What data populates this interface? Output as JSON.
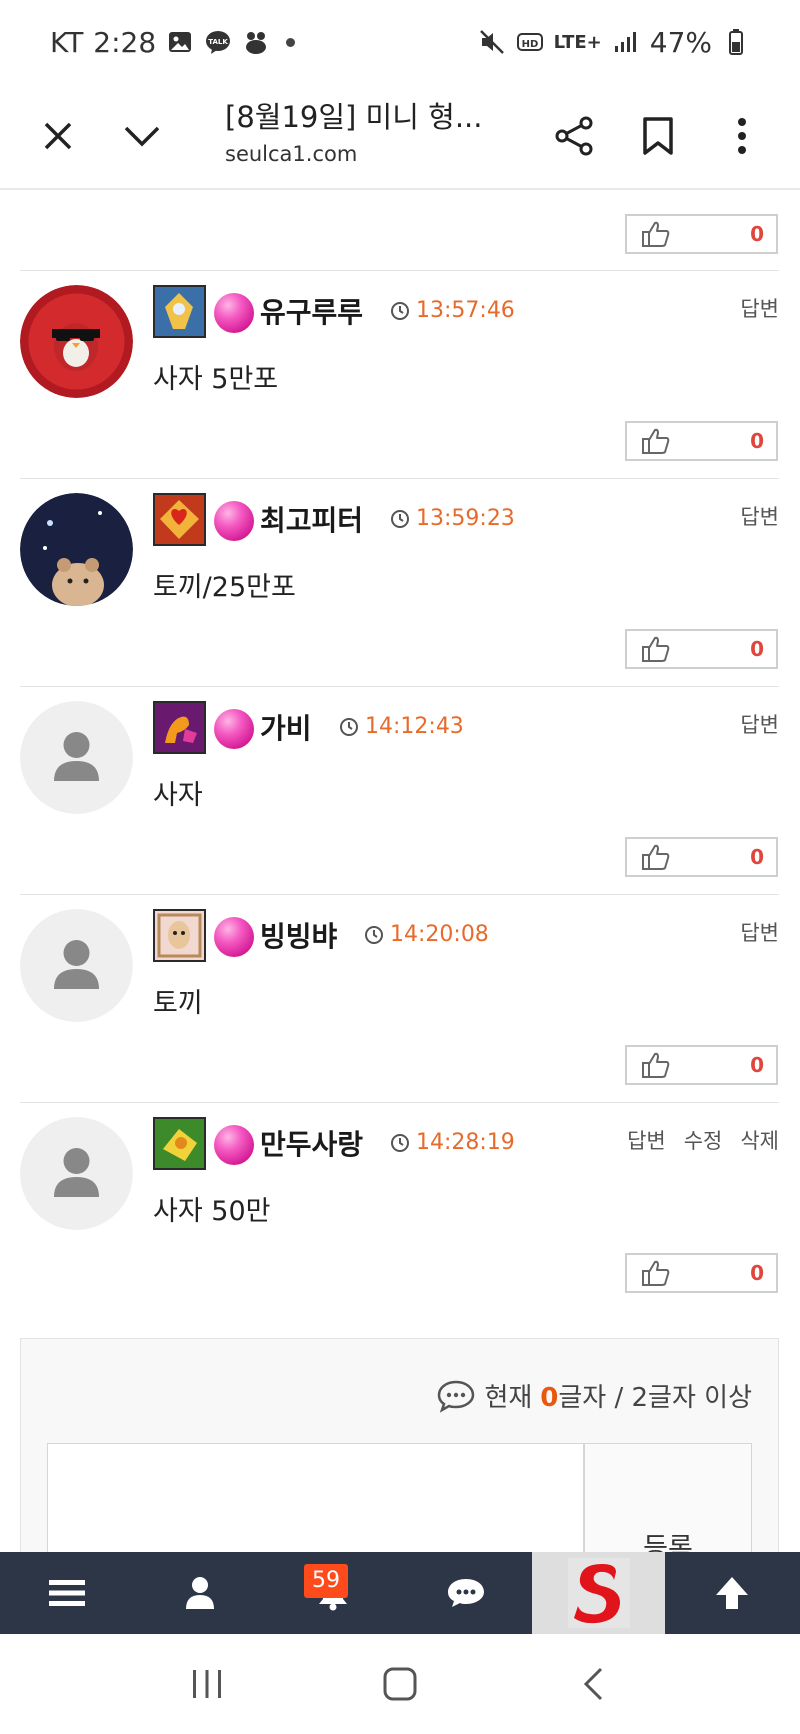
{
  "status_bar": {
    "carrier": "KT",
    "time": "2:28",
    "network": "LTE+",
    "battery": "47%"
  },
  "browser": {
    "title": "[8월19일] 미니 형...",
    "url": "seulca1.com"
  },
  "top_like": {
    "count": "0"
  },
  "comments": [
    {
      "nick": "유구루루",
      "time": "13:57:46",
      "body": "사자 5만포",
      "likes": "0",
      "actions": [
        "답변"
      ],
      "avatar": "red-penguin"
    },
    {
      "nick": "최고피터",
      "time": "13:59:23",
      "body": "토끼/25만포",
      "likes": "0",
      "actions": [
        "답변"
      ],
      "avatar": "night-bear"
    },
    {
      "nick": "가비",
      "time": "14:12:43",
      "body": "사자",
      "likes": "0",
      "actions": [
        "답변"
      ],
      "avatar": "default"
    },
    {
      "nick": "빙빙뱌",
      "time": "14:20:08",
      "body": "토끼",
      "likes": "0",
      "actions": [
        "답변"
      ],
      "avatar": "default"
    },
    {
      "nick": "만두사랑",
      "time": "14:28:19",
      "body": "사자 50만",
      "likes": "0",
      "actions": [
        "답변",
        "수정",
        "삭제"
      ],
      "avatar": "default"
    }
  ],
  "write": {
    "counter_prefix": "현재",
    "counter_value": "0",
    "counter_suffix": "글자 / 2글자 이상",
    "submit": "등록"
  },
  "bottom_nav": {
    "notification_count": "59"
  },
  "colors": {
    "time": "#e86a2a",
    "like_count": "#e0463b",
    "nav_bg": "#2c3646",
    "badge": "#ff4a1c"
  }
}
